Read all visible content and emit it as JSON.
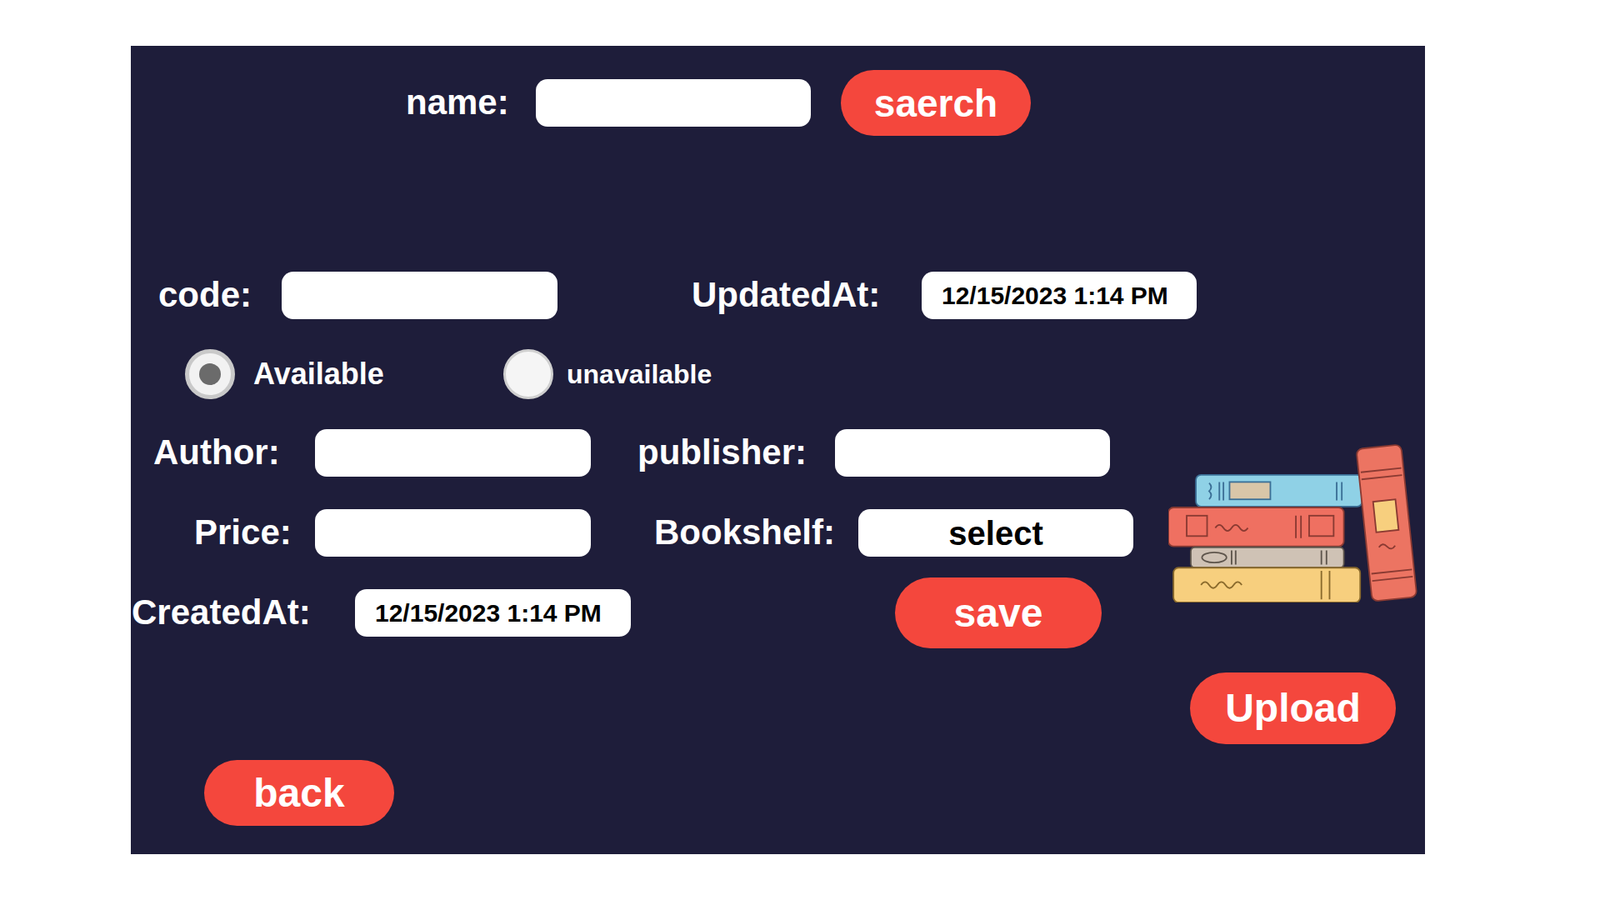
{
  "search": {
    "label": "name:",
    "value": "",
    "button": "saerch"
  },
  "form": {
    "code": {
      "label": "code:",
      "value": ""
    },
    "updated_at": {
      "label": "UpdatedAt:",
      "value": "12/15/2023 1:14 PM"
    },
    "status": [
      {
        "label": "Available",
        "selected": true
      },
      {
        "label": "unavailable",
        "selected": false
      }
    ],
    "author": {
      "label": "Author:",
      "value": ""
    },
    "publisher": {
      "label": "publisher:",
      "value": ""
    },
    "price": {
      "label": "Price:",
      "value": ""
    },
    "bookshelf": {
      "label": "Bookshelf:",
      "value": "select"
    },
    "created_at": {
      "label": "CreatedAt:",
      "value": "12/15/2023 1:14 PM"
    }
  },
  "buttons": {
    "save": "save",
    "upload": "Upload",
    "back": "back"
  }
}
